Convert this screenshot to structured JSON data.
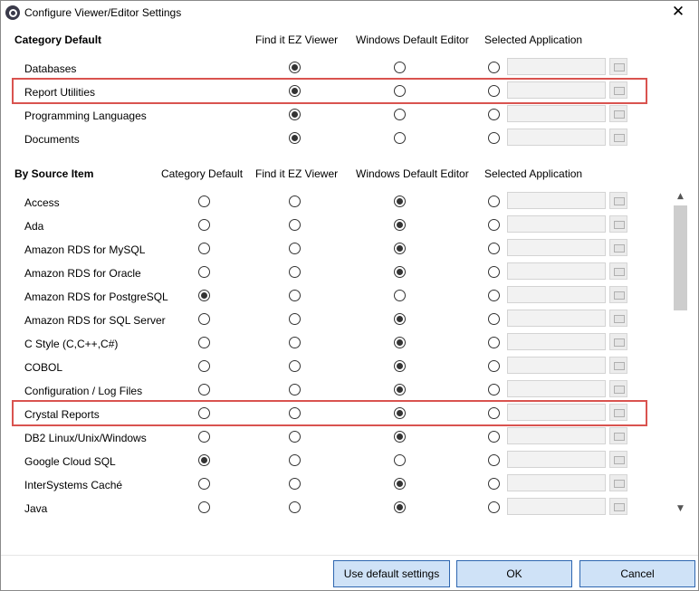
{
  "window": {
    "title": "Configure Viewer/Editor Settings",
    "close_glyph": "✕",
    "icon": "app-logo-icon"
  },
  "category_section": {
    "heading": "Category Default",
    "columns": [
      "Find it EZ Viewer",
      "Windows Default Editor",
      "Selected Application"
    ],
    "rows": [
      {
        "label": "Databases",
        "selected": "Find it EZ Viewer",
        "highlighted": false
      },
      {
        "label": "Report Utilities",
        "selected": "Find it EZ Viewer",
        "highlighted": true
      },
      {
        "label": "Programming Languages",
        "selected": "Find it EZ Viewer",
        "highlighted": false
      },
      {
        "label": "Documents",
        "selected": "Find it EZ Viewer",
        "highlighted": false
      }
    ]
  },
  "source_section": {
    "heading": "By Source Item",
    "columns": [
      "Category Default",
      "Find it EZ Viewer",
      "Windows Default Editor",
      "Selected Application"
    ],
    "rows": [
      {
        "label": "Access",
        "selected": "Windows Default Editor",
        "highlighted": false
      },
      {
        "label": "Ada",
        "selected": "Windows Default Editor",
        "highlighted": false
      },
      {
        "label": "Amazon RDS for MySQL",
        "selected": "Windows Default Editor",
        "highlighted": false
      },
      {
        "label": "Amazon RDS for Oracle",
        "selected": "Windows Default Editor",
        "highlighted": false
      },
      {
        "label": "Amazon RDS for PostgreSQL",
        "selected": "Category Default",
        "highlighted": false
      },
      {
        "label": "Amazon RDS for SQL Server",
        "selected": "Windows Default Editor",
        "highlighted": false
      },
      {
        "label": "C Style (C,C++,C#)",
        "selected": "Windows Default Editor",
        "highlighted": false
      },
      {
        "label": "COBOL",
        "selected": "Windows Default Editor",
        "highlighted": false
      },
      {
        "label": "Configuration / Log Files",
        "selected": "Windows Default Editor",
        "highlighted": false
      },
      {
        "label": "Crystal Reports",
        "selected": "Windows Default Editor",
        "highlighted": true
      },
      {
        "label": "DB2 Linux/Unix/Windows",
        "selected": "Windows Default Editor",
        "highlighted": false
      },
      {
        "label": "Google Cloud SQL",
        "selected": "Category Default",
        "highlighted": false
      },
      {
        "label": "InterSystems Caché",
        "selected": "Windows Default Editor",
        "highlighted": false
      },
      {
        "label": "Java",
        "selected": "Windows Default Editor",
        "highlighted": false
      }
    ]
  },
  "scrollbar": {
    "up_glyph": "▲",
    "down_glyph": "▼"
  },
  "buttons": {
    "defaults": "Use default settings",
    "ok": "OK",
    "cancel": "Cancel"
  }
}
